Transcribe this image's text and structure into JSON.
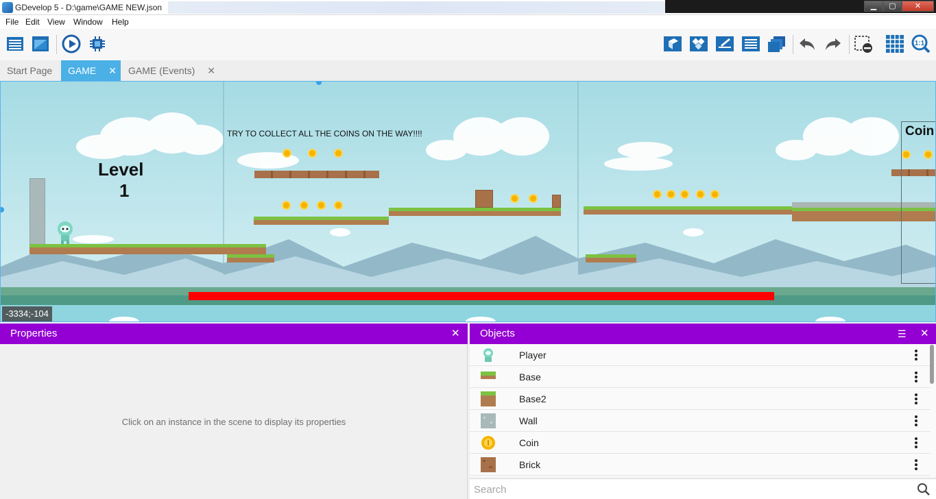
{
  "window": {
    "title": "GDevelop 5 - D:\\game\\GAME NEW.json"
  },
  "menu": [
    "File",
    "Edit",
    "View",
    "Window",
    "Help"
  ],
  "toolbar": {
    "icons_left": [
      "project-manager-icon",
      "scene-window-icon",
      "preview-play-icon",
      "debugger-icon"
    ],
    "icons_right": [
      "objects-panel-icon",
      "object-groups-icon",
      "properties-icon",
      "layers-icon",
      "instances-list-icon",
      "undo-icon",
      "redo-icon",
      "hide-scene-icon",
      "grid-icon",
      "zoom-reset-icon"
    ]
  },
  "tabs": [
    {
      "label": "Start Page",
      "active": false,
      "closable": false
    },
    {
      "label": "GAME",
      "active": true,
      "closable": true
    },
    {
      "label": "GAME (Events)",
      "active": false,
      "closable": true
    }
  ],
  "scene": {
    "level_text_1": "Level",
    "level_text_2": "1",
    "hint_text": "TRY TO COLLECT ALL THE COINS ON THE WAY!!!!",
    "coin_label": "Coin",
    "cursor_coords": "-3334;-104"
  },
  "properties_panel": {
    "title": "Properties",
    "empty_message": "Click on an instance in the scene to display its properties"
  },
  "objects_panel": {
    "title": "Objects",
    "items": [
      {
        "name": "Player",
        "icon": "player-icon"
      },
      {
        "name": "Base",
        "icon": "base-tile-icon"
      },
      {
        "name": "Base2",
        "icon": "base2-tile-icon"
      },
      {
        "name": "Wall",
        "icon": "wall-tile-icon"
      },
      {
        "name": "Coin",
        "icon": "coin-icon"
      },
      {
        "name": "Brick",
        "icon": "brick-icon"
      }
    ],
    "search_placeholder": "Search"
  },
  "colors": {
    "panel_header": "#9400d3",
    "active_tab": "#4ab0e6",
    "sky": "#a8dde4",
    "grass": "#7cc242",
    "dirt": "#b07c4f",
    "coin": "#f4b400",
    "lava": "#ff0000"
  }
}
